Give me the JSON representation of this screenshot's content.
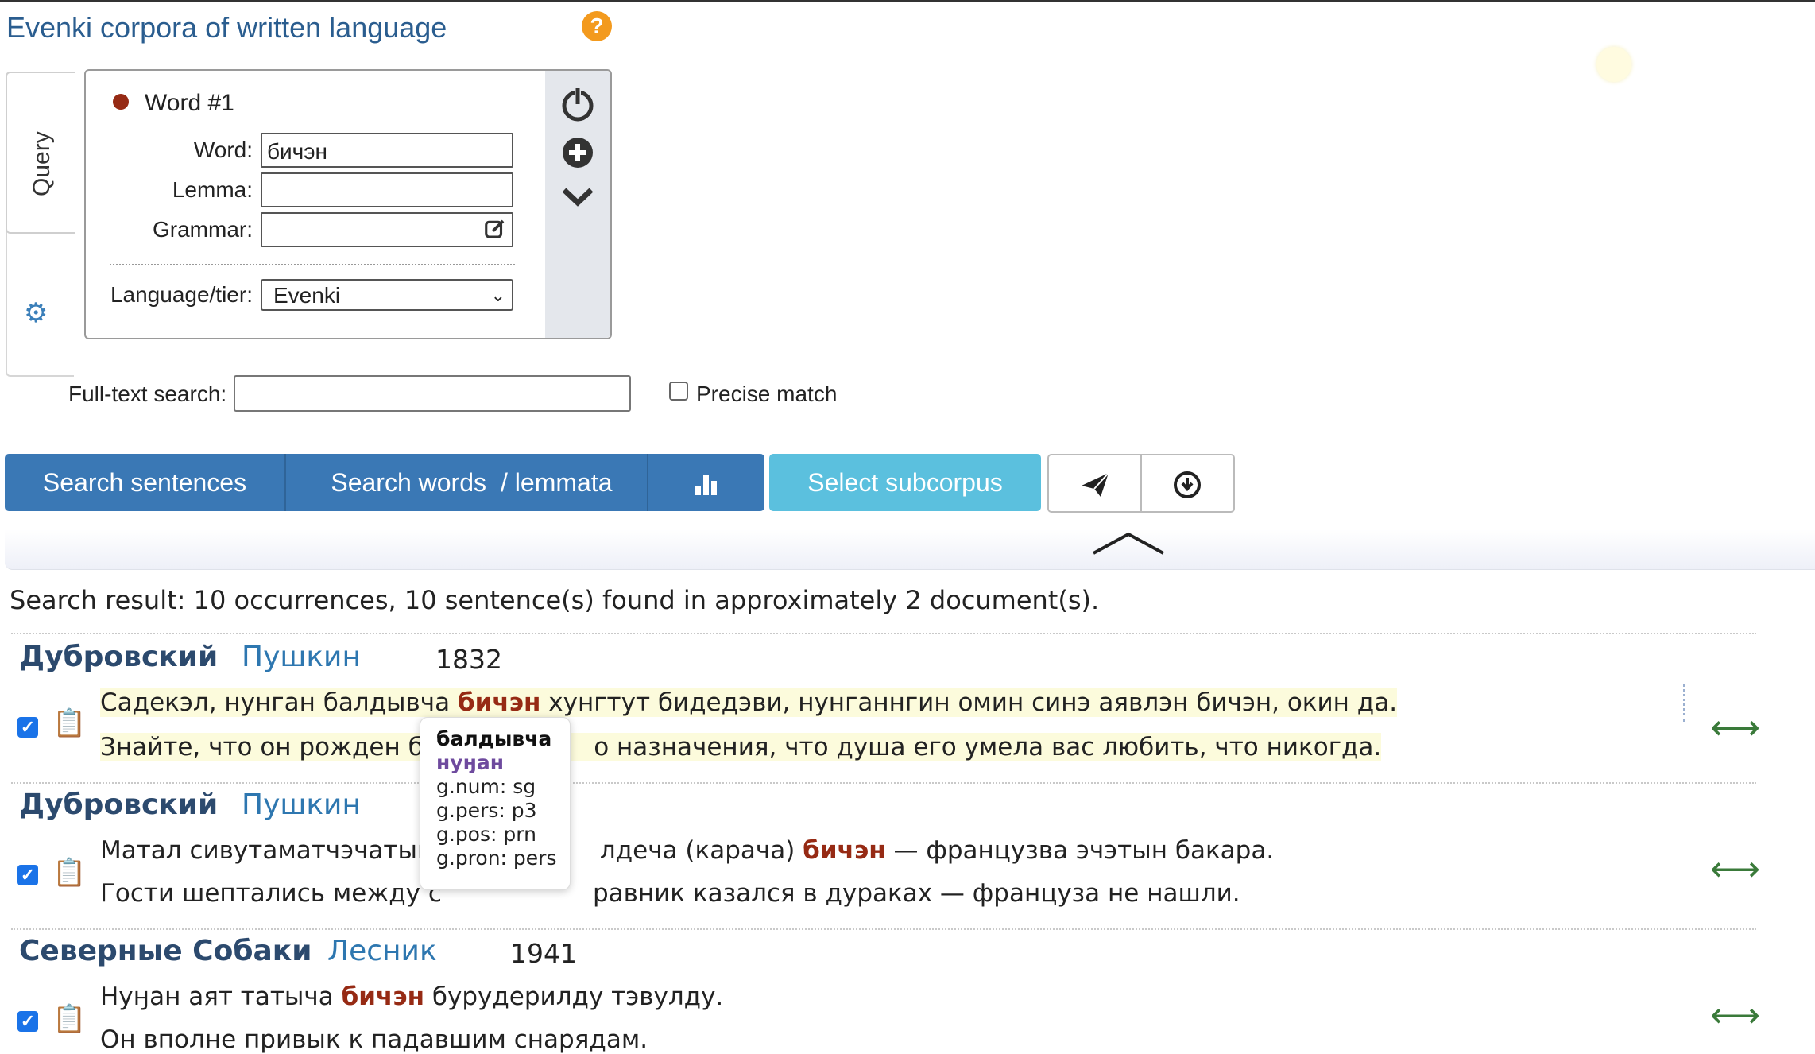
{
  "app": {
    "title": "Evenki corpora of written language"
  },
  "side_tabs": {
    "query_label": "Query"
  },
  "word_block": {
    "header": "Word #1",
    "word_label": "Word:",
    "word_value": "бичэн",
    "lemma_label": "Lemma:",
    "lemma_value": "",
    "grammar_label": "Grammar:",
    "grammar_value": "",
    "language_label": "Language/tier:",
    "language_value": "Evenki"
  },
  "fulltext": {
    "label": "Full-text search:",
    "value": "",
    "precise_label": "Precise match",
    "precise_checked": false
  },
  "buttons": {
    "search_sentences": "Search sentences",
    "search_words": "Search words",
    "lemmata": "/ lemmata",
    "select_subcorpus": "Select subcorpus"
  },
  "results": {
    "summary": "Search result: 10 occurrences, 10 sentence(s) found in approximately 2 document(s).",
    "items": [
      {
        "title": "Дубровский",
        "author": "Пушкин",
        "year": "1832",
        "pre": "Садекэл, нунган балдывча ",
        "hit": "бичэн",
        "post": " хунгтут бидедэви, нунганнгин омин синэ аявлэн бичэн, окин да.",
        "translation": "Знайте, что он рожден бы",
        "translation_tail": "о назначения, что душа его умела вас любить, что никогда."
      },
      {
        "title": "Дубровский",
        "author": "Пушкин",
        "year": "",
        "pre": "Матал сивутаматчэчатын, ",
        "pre_tail": "лдеча (карача) ",
        "hit": "бичэн",
        "post": " — французва эчэтын бакара.",
        "translation": "Гости шептались между с",
        "translation_tail": "равник казался в дураках — француза не нашли."
      },
      {
        "title": "Северные Собаки",
        "author": "Лесник",
        "year": "1941",
        "pre": "Нуӈан аят татыча ",
        "hit": "бичэн",
        "post": " бурудерилду тэвулду.",
        "translation": "Он вполне привык к падавшим снарядам."
      }
    ]
  },
  "tooltip": {
    "word": "балдывча",
    "lemma": "нуӈан",
    "features": [
      "g.num: sg",
      "g.pers: p3",
      "g.pos: prn",
      "g.pron: pers"
    ]
  },
  "colors": {
    "accent": "#3a78b5",
    "subcorpus": "#5bc0de",
    "hit": "#962a14",
    "title": "#2a5d8f"
  },
  "icons": [
    "help-icon",
    "gear-icon",
    "power-icon",
    "plus-circle-icon",
    "chevron-down-icon",
    "edit-icon",
    "bar-chart-icon",
    "send-icon",
    "download-icon",
    "chevron-up-icon",
    "clipboard-icon",
    "expand-arrows-icon"
  ]
}
